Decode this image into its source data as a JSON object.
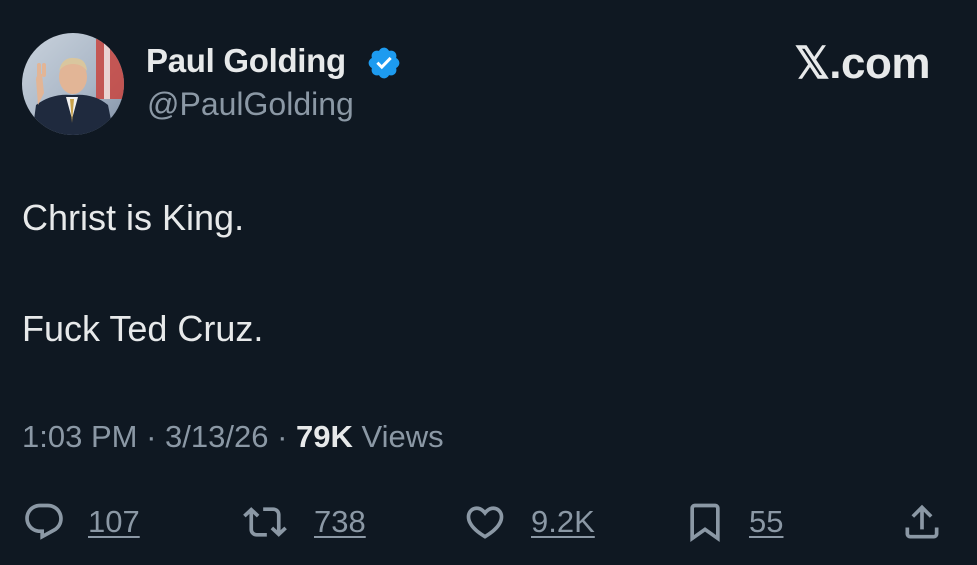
{
  "author": {
    "display_name": "Paul Golding",
    "handle": "@PaulGolding",
    "verified": true,
    "verified_badge_color": "#1d9bf0"
  },
  "brand": "𝕏.com",
  "tweet": {
    "lines": [
      "Christ is King.",
      "Fuck Ted Cruz."
    ]
  },
  "meta": {
    "time": "1:03 PM",
    "separator": "·",
    "date": "3/13/26",
    "views_count": "79K",
    "views_label": "Views"
  },
  "actions": {
    "replies": "107",
    "reposts": "738",
    "likes": "9.2K",
    "bookmarks": "55"
  },
  "icons": {
    "reply": "reply-icon",
    "repost": "repost-icon",
    "like": "heart-icon",
    "bookmark": "bookmark-icon",
    "share": "share-icon"
  },
  "colors": {
    "background": "#0f1822",
    "text_primary": "#e7e9ea",
    "text_secondary": "#8b98a5",
    "accent": "#1d9bf0"
  }
}
